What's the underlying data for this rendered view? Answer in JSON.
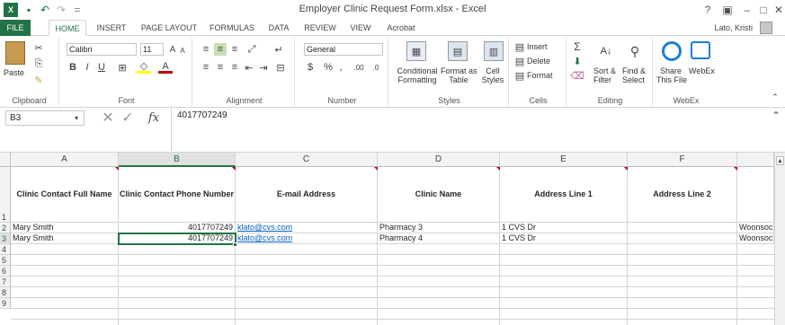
{
  "window": {
    "title": "Employer Clinic Request Form.xlsx - Excel",
    "help": "?",
    "minimize": "–",
    "restore": "□",
    "close": "✕"
  },
  "quick_access": {
    "save": "💾",
    "undo": "↶",
    "redo": "↷",
    "customize": "="
  },
  "tabs": [
    "FILE",
    "HOME",
    "INSERT",
    "PAGE LAYOUT",
    "FORMULAS",
    "DATA",
    "REVIEW",
    "VIEW",
    "Acrobat"
  ],
  "user": "Lato, Kristi",
  "ribbon": {
    "clipboard": {
      "label": "Clipboard",
      "paste": "Paste"
    },
    "font": {
      "label": "Font",
      "name": "Calibri",
      "size": "11",
      "bold": "B",
      "italic": "I",
      "underline": "U"
    },
    "alignment": {
      "label": "Alignment"
    },
    "number": {
      "label": "Number",
      "format": "General",
      "currency": "$",
      "percent": "%",
      "comma": ",",
      "inc": ".00",
      "dec": ".0"
    },
    "styles": {
      "label": "Styles",
      "conditional": "Conditional",
      "conditional2": "Formatting",
      "format_as": "Format as",
      "format_as2": "Table",
      "cell": "Cell",
      "cell2": "Styles"
    },
    "cells": {
      "label": "Cells",
      "insert": "Insert",
      "delete": "Delete",
      "format": "Format"
    },
    "editing": {
      "label": "Editing",
      "sort": "Sort &",
      "sort2": "Filter",
      "find": "Find &",
      "find2": "Select"
    },
    "webex": {
      "label": "WebEx",
      "share": "Share",
      "share2": "This File",
      "webex": "WebEx"
    }
  },
  "formula_bar": {
    "name_box": "B3",
    "fx": "fx",
    "value": "4017707249"
  },
  "columns": [
    "A",
    "B",
    "C",
    "D",
    "E",
    "F"
  ],
  "rows": [
    "1",
    "2",
    "3",
    "4",
    "5",
    "6",
    "7",
    "8",
    "9"
  ],
  "headers": [
    "Clinic Contact Full Name",
    "Clinic Contact Phone Number",
    "E-mail Address",
    "Clinic Name",
    "Address Line 1",
    "Address Line 2"
  ],
  "data": [
    [
      "Mary Smith",
      "4017707249",
      "klato@cvs.com",
      "Pharmacy 3",
      "1 CVS Dr",
      "",
      "Woonsocket"
    ],
    [
      "Mary Smith",
      "4017707249",
      "klato@cvs.com",
      "Pharmacy 4",
      "1 CVS Dr",
      "",
      "Woonsocket"
    ]
  ]
}
